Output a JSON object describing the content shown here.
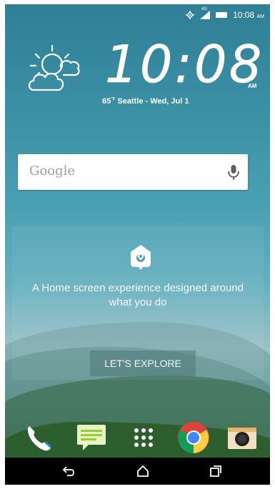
{
  "status_bar": {
    "time": "10:08",
    "ampm": "AM",
    "network_tag": "4G",
    "icons": [
      "gps-icon",
      "signal-icon",
      "battery-icon"
    ]
  },
  "clock_widget": {
    "time": "10:08",
    "ampm": "AM",
    "temperature": "65",
    "unit": "°F",
    "location_date": "Seattle - Wed, Jul 1",
    "weather_icon": "partly-cloudy-icon"
  },
  "search": {
    "placeholder": "Google",
    "mic_icon": "mic-icon"
  },
  "intro": {
    "icon": "home-pin-icon",
    "message_line1": "A Home screen experience designed around",
    "message_line2": "what you do",
    "button_label": "LET'S EXPLORE"
  },
  "dock": {
    "apps": [
      "Phone",
      "Messages",
      "Apps",
      "Chrome",
      "Camera"
    ]
  },
  "nav": {
    "buttons": [
      "back-icon",
      "home-icon",
      "recents-icon"
    ]
  },
  "colors": {
    "sky_top": "#2f7f95",
    "accent_white": "#ffffff",
    "nav_black": "#000000"
  }
}
